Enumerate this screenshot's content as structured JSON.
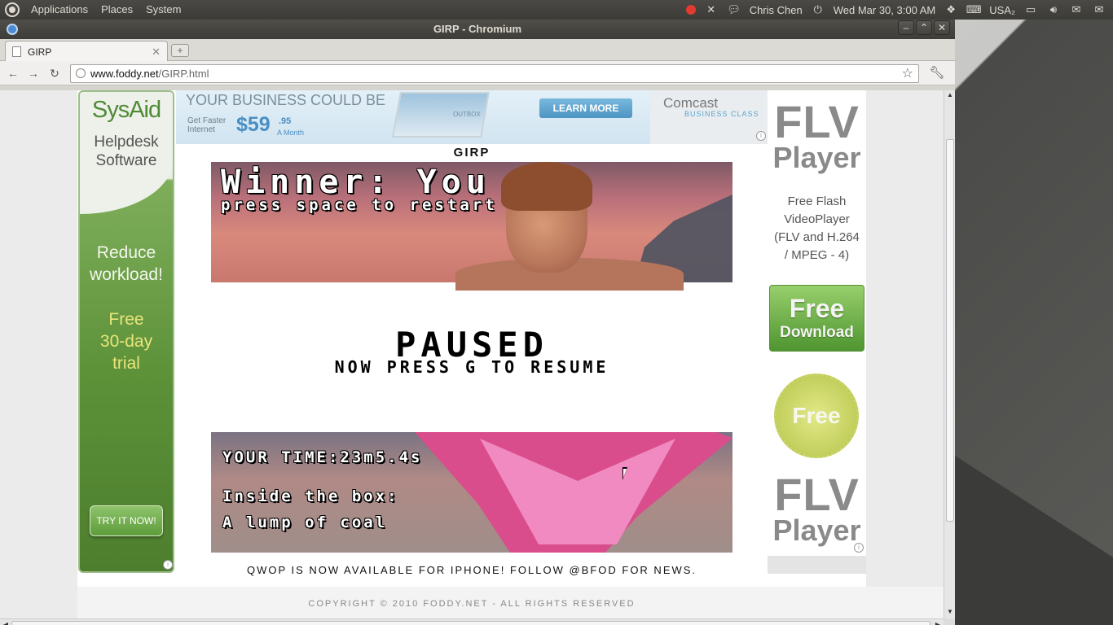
{
  "top_panel": {
    "menus": [
      "Applications",
      "Places",
      "System"
    ],
    "user": "Chris Chen",
    "datetime": "Wed Mar 30, 3:00 AM",
    "keyboard": "USA₂"
  },
  "window": {
    "title": "GIRP - Chromium",
    "tab_title": "GIRP",
    "url_host": "www.foddy.net",
    "url_path": "/GIRP.html"
  },
  "ads": {
    "left": {
      "brand": "SysAid",
      "subtitle_line1": "Helpdesk",
      "subtitle_line2": "Software",
      "reduce_line1": "Reduce",
      "reduce_line2": "workload!",
      "free_line1": "Free",
      "free_line2": "30-day",
      "free_line3": "trial",
      "cta": "TRY IT NOW!"
    },
    "banner": {
      "headline": "YOUR BUSINESS COULD BE",
      "faster_line1": "Get Faster",
      "faster_line2": "Internet",
      "price": "$59",
      "cents": ".95",
      "per": "A Month",
      "outbox": "OUTBOX",
      "cta": "LEARN MORE",
      "brand": "Comcast",
      "brand_sub": "BUSINESS CLASS"
    },
    "right": {
      "flv": "FLV",
      "player": "Player",
      "desc_line1": "Free Flash",
      "desc_line2": "VideoPlayer",
      "desc_line3": "(FLV and H.264",
      "desc_line4": "/ MPEG - 4)",
      "dl_line1": "Free",
      "dl_line2": "Download",
      "seal": "Free"
    }
  },
  "game": {
    "title": "GIRP",
    "winner": "Winner: You",
    "press": "press space to restart",
    "paused": "PAUSED",
    "resume": "NOW PRESS G TO RESUME",
    "time": "YOUR TIME:23m5.4s",
    "inside": "Inside the box:",
    "prize": "A lump of coal"
  },
  "footer": {
    "news": "QWOP IS NOW AVAILABLE FOR IPHONE! FOLLOW @BFOD FOR NEWS.",
    "copyright": "COPYRIGHT © 2010 FODDY.NET - ALL RIGHTS RESERVED"
  }
}
